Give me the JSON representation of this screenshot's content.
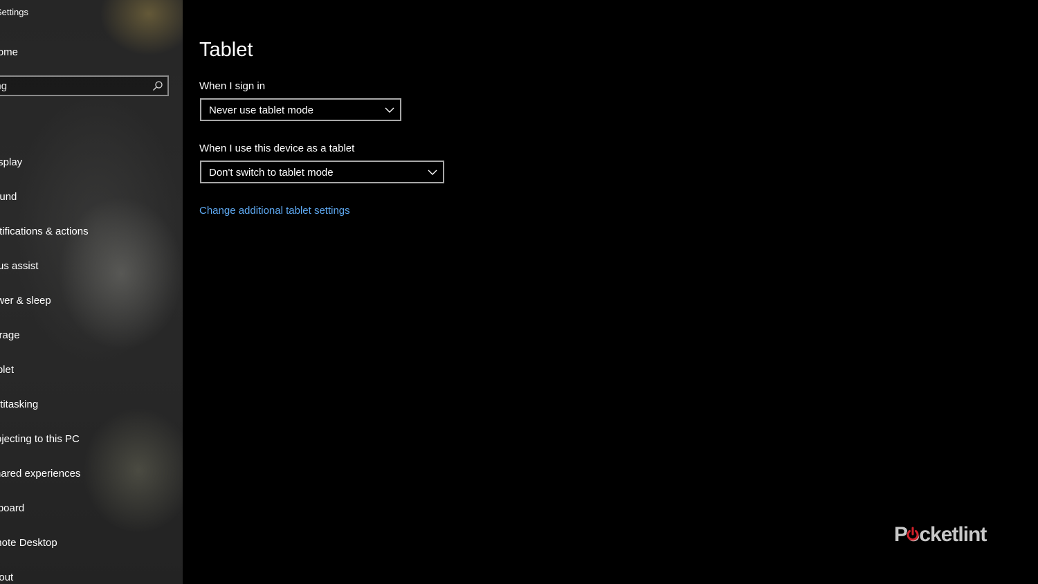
{
  "sidebar": {
    "title": "Settings",
    "home_label": "Home",
    "search": {
      "value": "Find a setting"
    },
    "items": [
      {
        "label": "Display"
      },
      {
        "label": "Sound"
      },
      {
        "label": "Notifications & actions"
      },
      {
        "label": "Focus assist"
      },
      {
        "label": "Power & sleep"
      },
      {
        "label": "Storage"
      },
      {
        "label": "Tablet"
      },
      {
        "label": "Multitasking"
      },
      {
        "label": "Projecting to this PC"
      },
      {
        "label": "Shared experiences"
      },
      {
        "label": "Clipboard"
      },
      {
        "label": "Remote Desktop"
      },
      {
        "label": "About"
      }
    ]
  },
  "main": {
    "title": "Tablet",
    "sign_in": {
      "label": "When I sign in",
      "value": "Never use tablet mode"
    },
    "tablet_use": {
      "label": "When I use this device as a tablet",
      "value": "Don't switch to tablet mode"
    },
    "link": "Change additional tablet settings"
  },
  "watermark": {
    "text": "Pocketlint",
    "icon": "power-icon"
  },
  "colors": {
    "background": "#000000",
    "sidebar": "#272727",
    "accent_link": "#5ea9f2",
    "dropdown_border": "#a8a8a8",
    "watermark_text": "#c8c8c8",
    "watermark_icon": "#d0202a"
  }
}
